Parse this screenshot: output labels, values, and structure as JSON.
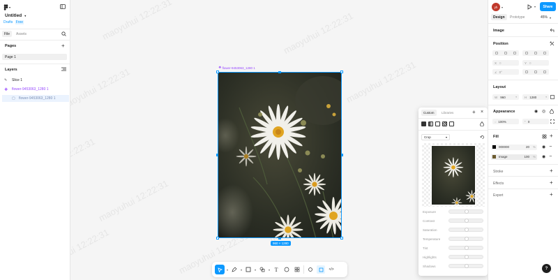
{
  "file": {
    "title": "Untitled",
    "drafts": "Drafts",
    "plan": "Free"
  },
  "left_tabs": {
    "file": "File",
    "assets": "Assets"
  },
  "pages": {
    "heading": "Pages",
    "items": [
      "Page 1"
    ]
  },
  "layers": {
    "heading": "Layers",
    "items": [
      {
        "name": "Slice 1",
        "icon": "slice-icon"
      },
      {
        "name": "flower-9453063_1280 1",
        "icon": "component-icon"
      },
      {
        "name": "flower-9453063_1280 1",
        "icon": "image-icon"
      }
    ]
  },
  "canvas": {
    "frame_label": "flower-9453063_1280 1",
    "size_badge": "960 × 1280",
    "watermark": "maoyuhui 12:22:31"
  },
  "toolbar": {
    "tools": [
      "move-tool",
      "pen-tool",
      "shape-tool",
      "component-tool",
      "text-tool",
      "comment-tool",
      "actions-tool",
      "dev-mode-toggle",
      "code-toggle"
    ]
  },
  "header_right": {
    "avatar": "yh",
    "share": "Share",
    "tab_design": "Design",
    "tab_prototype": "Prototype",
    "zoom": "45%"
  },
  "properties": {
    "image_heading": "Image",
    "position_heading": "Position",
    "x_label": "X",
    "x_value": "0",
    "y_label": "Y",
    "y_value": "0",
    "rotation": "0°",
    "layout_heading": "Layout",
    "w_label": "W",
    "w_value": "960",
    "h_label": "H",
    "h_value": "1280",
    "appearance_heading": "Appearance",
    "opacity": "100%",
    "radius": "0",
    "fill_heading": "Fill",
    "fills": [
      {
        "name": "000000",
        "opacity": "20",
        "unit": "%",
        "swatch": "#000000"
      },
      {
        "name": "Image",
        "opacity": "100",
        "unit": "%",
        "swatch": "image"
      }
    ],
    "stroke_heading": "Stroke",
    "effects_heading": "Effects",
    "export_heading": "Export"
  },
  "image_popover": {
    "tab_custom": "Custom",
    "tab_libraries": "Libraries",
    "mode": "Crop",
    "adjustments": [
      {
        "label": "Exposure",
        "value": 0.5
      },
      {
        "label": "Contrast",
        "value": 0.5
      },
      {
        "label": "Saturation",
        "value": 0.5
      },
      {
        "label": "Temperature",
        "value": 0.5
      },
      {
        "label": "Tint",
        "value": 0.5
      },
      {
        "label": "Highlights",
        "value": 0.5
      },
      {
        "label": "Shadows",
        "value": 0.5
      }
    ]
  },
  "help": "?",
  "colors": {
    "accent": "#0d99ff",
    "component": "#9747ff",
    "share": "#0d99ff"
  }
}
